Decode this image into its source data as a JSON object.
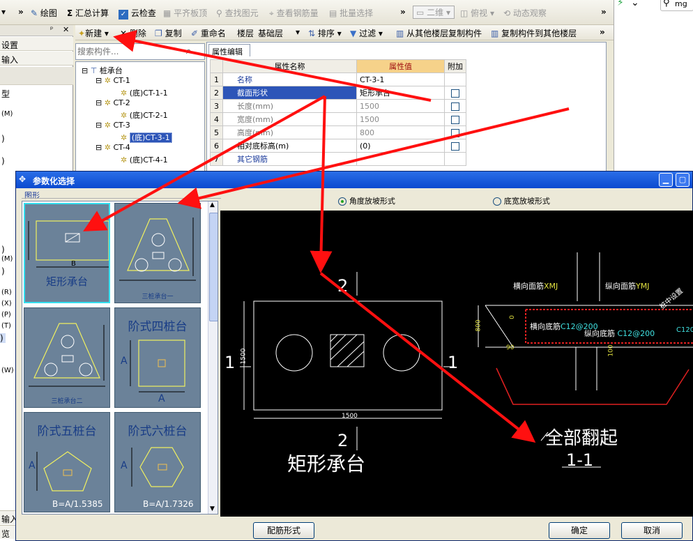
{
  "toolbar": {
    "draw": "绘图",
    "sum_calc": "汇总计算",
    "cloud_check": "云检查",
    "flat_top": "平齐板顶",
    "find_element": "查找图元",
    "view_rebar": "查看钢筋量",
    "batch_select": "批量选择",
    "view_mode": "二维",
    "top_view": "俯视",
    "dynamic_view": "动态观察"
  },
  "toolbar2": {
    "new": "新建",
    "delete": "删除",
    "copy": "复制",
    "rename": "重命名",
    "floor_label": "楼层",
    "floor_value": "基础层",
    "sort": "排序",
    "filter": "过滤",
    "copy_from_floor": "从其他楼层复制构件",
    "copy_to_floor": "复制构件到其他楼层"
  },
  "left_panel": {
    "settings": "设置",
    "input": "输入",
    "input2": "输入",
    "preview": "览",
    "fragments": [
      "型",
      "(M)",
      ")",
      ")",
      ")",
      "(M)",
      ")",
      "(R)",
      "(X)",
      "(P)",
      "(T)",
      ")",
      "(W)"
    ]
  },
  "search": {
    "placeholder": "搜索构件..."
  },
  "tree": {
    "root": "桩承台",
    "items": [
      "CT-1",
      "(底)CT-1-1",
      "CT-2",
      "(底)CT-2-1",
      "CT-3",
      "(底)CT-3-1",
      "CT-4",
      "(底)CT-4-1"
    ]
  },
  "props": {
    "tab": "属性编辑",
    "headers": [
      "属性名称",
      "属性值",
      "附加"
    ],
    "rows": [
      {
        "no": "1",
        "name": "名称",
        "value": "CT-3-1"
      },
      {
        "no": "2",
        "name": "截面形状",
        "value": "矩形承台"
      },
      {
        "no": "3",
        "name": "长度(mm)",
        "value": "1500"
      },
      {
        "no": "4",
        "name": "宽度(mm)",
        "value": "1500"
      },
      {
        "no": "5",
        "name": "高度(mm)",
        "value": "800"
      },
      {
        "no": "6",
        "name": "相对底标高(m)",
        "value": "(0)"
      },
      {
        "no": "7",
        "name": "其它钢筋",
        "value": ""
      }
    ]
  },
  "dialog": {
    "title": "参数化选择",
    "group_label": "图形",
    "radio1": "角度放坡形式",
    "radio2": "底宽放坡形式",
    "rebar_form": "配筋形式",
    "ok": "确定",
    "cancel": "取消"
  },
  "thumbs": {
    "t1_caption": "矩形承台",
    "t1_dim": "B",
    "t2_caption": "三桩承台一",
    "t3_caption": "三桩承台二",
    "t4_caption": "阶式四桩台",
    "t4_dim": "A",
    "t5_caption": "阶式五桩台",
    "t5_formula": "B=A/1.5385",
    "t6_caption": "阶式六桩台",
    "t6_formula": "B=A/1.7326",
    "a_label": "A"
  },
  "drawing": {
    "num_2": "2",
    "num_1": "1",
    "dim_1500": "1500",
    "plan_caption": "矩形承台",
    "section_caption": "全部翻起",
    "section_label": "1-1",
    "label_top_h": "横向面筋",
    "code_top_h": "XMJ",
    "label_top_v": "纵向面筋",
    "code_top_v": "YMJ",
    "label_bot_h": "横向底筋",
    "code_bot_h": "C12@200",
    "label_bot_v": "纵向底筋",
    "code_bot_v": "C12@200",
    "dim_800": "800",
    "dim_100": "100",
    "dim_0": "0",
    "angle": "90",
    "pile_note": "桩中设置",
    "code_right": "C120"
  }
}
